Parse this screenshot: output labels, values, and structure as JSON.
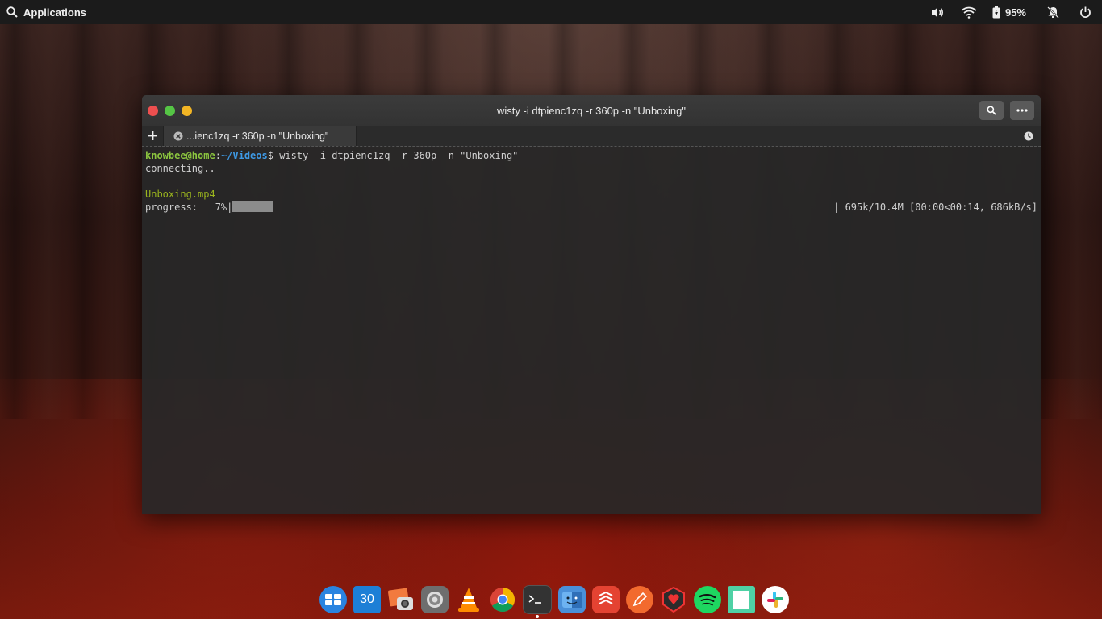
{
  "panel": {
    "applications_label": "Applications",
    "battery_percent": "95%",
    "icons": [
      "search-icon",
      "volume-icon",
      "wifi-icon",
      "battery-icon",
      "notifications-off-icon",
      "power-icon"
    ]
  },
  "window": {
    "title": "wisty -i dtpienc1zq -r 360p -n \"Unboxing\"",
    "tab_label": "...ienc1zq -r 360p -n \"Unboxing\""
  },
  "terminal": {
    "prompt_user": "knowbee@home",
    "prompt_sep": ":",
    "prompt_path": "~/Videos",
    "prompt_dollar": "$ ",
    "command": "wisty -i dtpienc1zq -r 360p -n \"Unboxing\"",
    "connecting": "connecting..",
    "filename": "Unboxing.mp4",
    "progress_label": "progress:   7%|",
    "progress_fraction": 0.07,
    "progress_stats": "| 695k/10.4M [00:00<00:14, 686kB/s]"
  },
  "dock": {
    "calendar_day": "30",
    "items": [
      "multitasking-view",
      "calendar",
      "photos",
      "system-settings",
      "vlc",
      "chrome",
      "terminal",
      "files",
      "todoist",
      "pen-app",
      "security-app",
      "spotify",
      "notes-app",
      "slack"
    ]
  },
  "colors": {
    "close": "#ed4f4f",
    "maximize": "#55c545",
    "minimize": "#f2b524",
    "prompt_user": "#8cc63f",
    "prompt_path": "#3e9ae6"
  }
}
